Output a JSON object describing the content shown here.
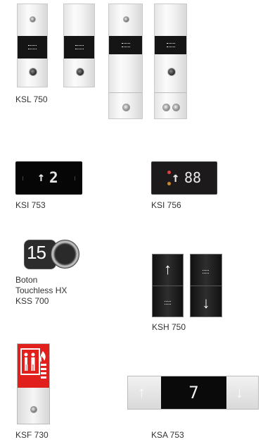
{
  "products": {
    "ksl750": {
      "caption": "KSL 750"
    },
    "ksi753": {
      "caption": "KSI 753",
      "arrow": "↑",
      "floor": "2"
    },
    "ksi756": {
      "caption": "KSI 756",
      "arrow": "↑",
      "floor": "88"
    },
    "kss700": {
      "caption_line1": "Boton",
      "caption_line2": "Touchless HX",
      "caption_line3": "KSS 700",
      "floor": "15"
    },
    "ksh750": {
      "caption": "KSH 750",
      "up_arrow": "↑",
      "down_arrow": "↓"
    },
    "ksf730": {
      "caption": "KSF 730"
    },
    "ksa753": {
      "caption": "KSA 753",
      "up_arrow": "↑",
      "down_arrow": "↓",
      "floor": "7"
    }
  },
  "colors": {
    "fire_red": "#e1201e",
    "glass_black": "#151515"
  }
}
